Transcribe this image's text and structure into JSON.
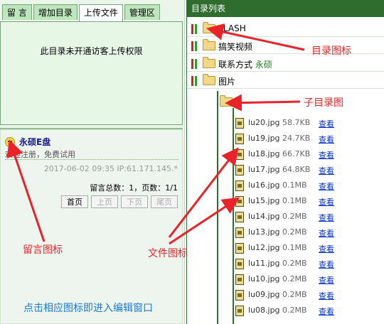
{
  "left_panel": {
    "tabs": [
      {
        "label": "留 言",
        "active": false
      },
      {
        "label": "增加目录",
        "active": false
      },
      {
        "label": "上传文件",
        "active": true
      },
      {
        "label": "管理区",
        "active": false
      }
    ],
    "permission_message": "此目录未开通访客上传权限",
    "message": {
      "user": "永硕E盘",
      "text": "欢迎注册，免费试用",
      "meta": "2017-06-02 09:35 IP:61.171.145.*"
    },
    "pager": {
      "info": "留言总数：1，页数：1/1",
      "buttons": [
        "首页",
        "上页",
        "下页",
        "尾页"
      ]
    }
  },
  "right_panel": {
    "header": "目录列表",
    "folders": [
      {
        "name": "FLASH",
        "note": ""
      },
      {
        "name": "搞笑视频",
        "note": ""
      },
      {
        "name": "联系方式",
        "note": "永硕"
      },
      {
        "name": "图片",
        "note": ""
      }
    ],
    "files": [
      {
        "name": "lu20.jpg",
        "size": "58.7KB",
        "action": "查看"
      },
      {
        "name": "lu19.jpg",
        "size": "24.7KB",
        "action": "查看"
      },
      {
        "name": "lu18.jpg",
        "size": "66.7KB",
        "action": "查看"
      },
      {
        "name": "lu17.jpg",
        "size": "64.8KB",
        "action": "查看"
      },
      {
        "name": "lu16.jpg",
        "size": "0.1MB",
        "action": "查看"
      },
      {
        "name": "lu15.jpg",
        "size": "0.1MB",
        "action": "查看"
      },
      {
        "name": "lu14.jpg",
        "size": "0.2MB",
        "action": "查看"
      },
      {
        "name": "lu13.jpg",
        "size": "0.2MB",
        "action": "查看"
      },
      {
        "name": "lu12.jpg",
        "size": "0.1MB",
        "action": "查看"
      },
      {
        "name": "lu11.jpg",
        "size": "0.2MB",
        "action": "查看"
      },
      {
        "name": "lu10.jpg",
        "size": "0.2MB",
        "action": "查看"
      },
      {
        "name": "lu09.jpg",
        "size": "0.2MB",
        "action": "查看"
      },
      {
        "name": "lu08.jpg",
        "size": "0.2MB",
        "action": "查看"
      }
    ]
  },
  "annotations": {
    "folder_icon": "目录图标",
    "subfolder_icon": "子目录图",
    "message_icon": "留言图标",
    "file_icon": "文件图标",
    "hint": "点击相应图标即进入编辑窗口"
  },
  "colors": {
    "annotation": "#e8232a",
    "hint": "#1a7bd1",
    "header_bg": "#2e6d2e",
    "link": "#0033cc"
  },
  "icons": [
    "smiley-icon",
    "folder-icon",
    "file-icon",
    "toggle-icon"
  ]
}
